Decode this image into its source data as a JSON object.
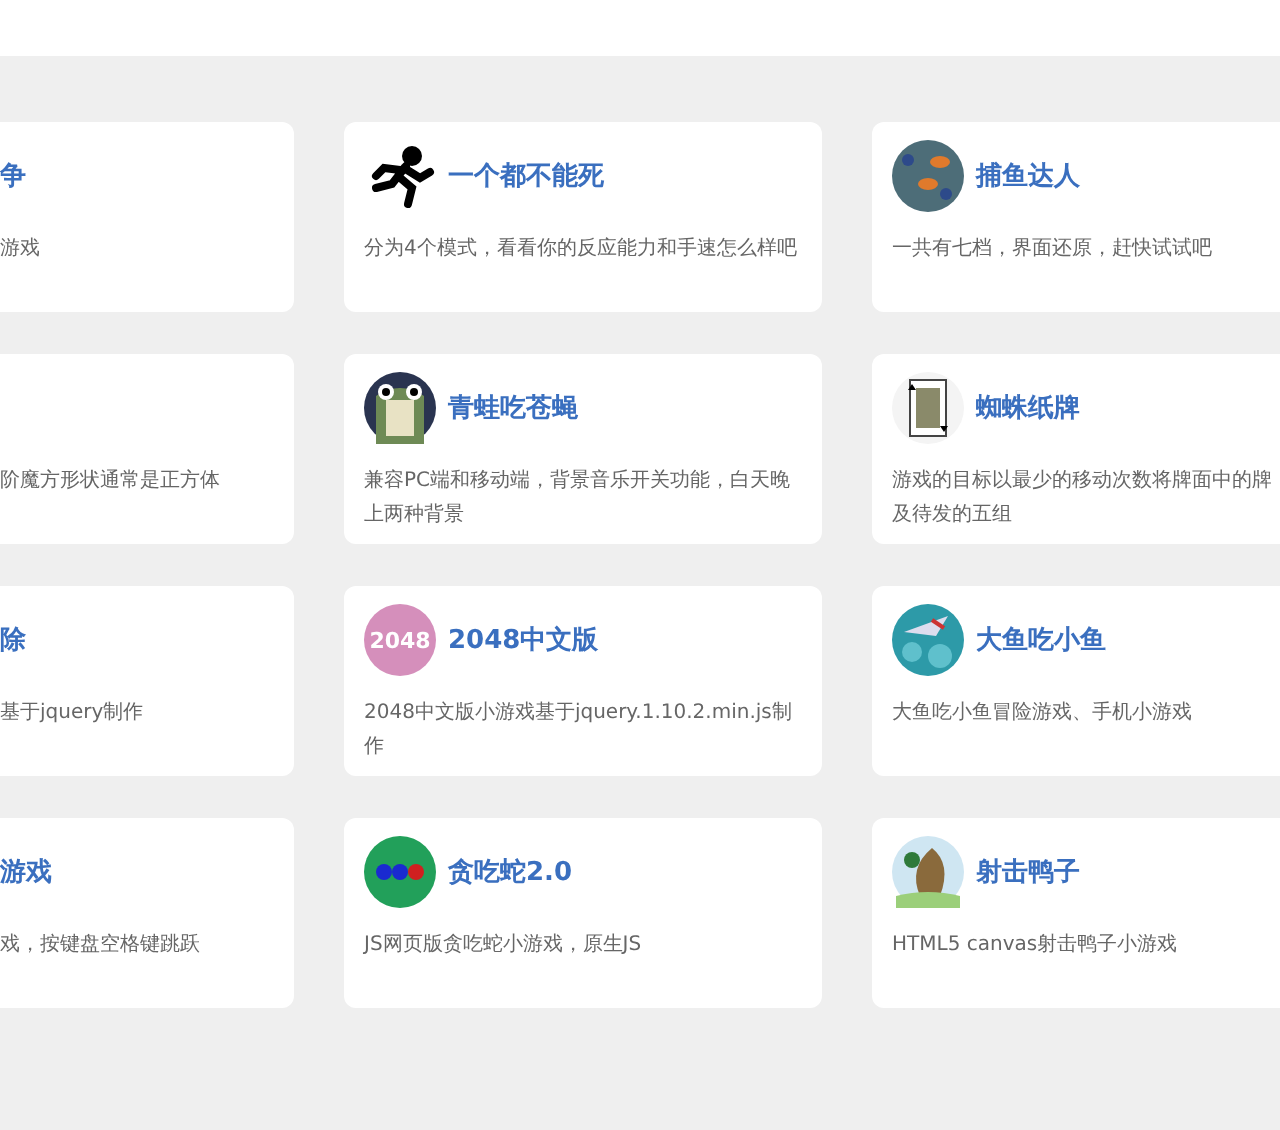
{
  "rows": [
    {
      "cards": [
        {
          "title": "争",
          "description": "游戏"
        },
        {
          "title": "一个都不能死",
          "description": "分为4个模式，看看你的反应能力和手速怎么样吧"
        },
        {
          "title": "捕鱼达人",
          "description": "一共有七档，界面还原，赶快试试吧"
        }
      ]
    },
    {
      "cards": [
        {
          "description": "阶魔方形状通常是正方体"
        },
        {
          "title": "青蛙吃苍蝇",
          "description": "兼容PC端和移动端，背景音乐开关功能，白天晚上两种背景"
        },
        {
          "title": "蜘蛛纸牌",
          "description": "游戏的目标以最少的移动次数将牌面中的牌及待发的五组"
        }
      ]
    },
    {
      "cards": [
        {
          "title": "除",
          "description": "基于jquery制作"
        },
        {
          "icon_text": "2048",
          "title": "2048中文版",
          "description": "2048中文版小游戏基于jquery.1.10.2.min.js制作"
        },
        {
          "title": "大鱼吃小鱼",
          "description": "大鱼吃小鱼冒险游戏、手机小游戏"
        }
      ]
    },
    {
      "cards": [
        {
          "title": "游戏",
          "description": "戏，按键盘空格键跳跃"
        },
        {
          "title": "贪吃蛇2.0",
          "description": "JS网页版贪吃蛇小游戏，原生JS"
        },
        {
          "title": "射击鸭子",
          "description": "HTML5 canvas射击鸭子小游戏"
        }
      ]
    }
  ]
}
